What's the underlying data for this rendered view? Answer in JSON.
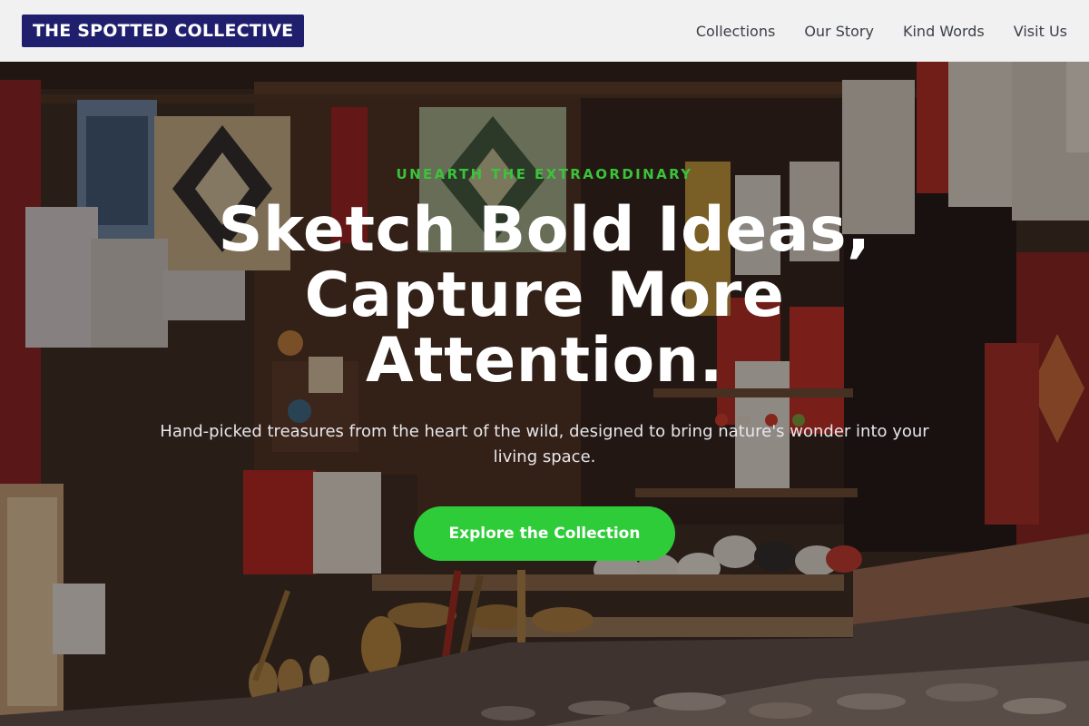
{
  "header": {
    "logo_text": "THE SPOTTED COLLECTIVE",
    "nav": [
      {
        "label": "Collections"
      },
      {
        "label": "Our Story"
      },
      {
        "label": "Kind Words"
      },
      {
        "label": "Visit Us"
      }
    ]
  },
  "hero": {
    "eyebrow": "UNEARTH THE EXTRAORDINARY",
    "headline": "Sketch Bold Ideas, Capture More Attention.",
    "subtitle": "Hand-picked treasures from the heart of the wild, designed to bring nature's wonder into your living space.",
    "cta_label": "Explore the Collection"
  },
  "colors": {
    "logo_bg": "#1f1f6e",
    "accent_green": "#2fcc3a",
    "eyebrow_green": "#3ac43a",
    "header_bg": "#f1f1f1"
  }
}
